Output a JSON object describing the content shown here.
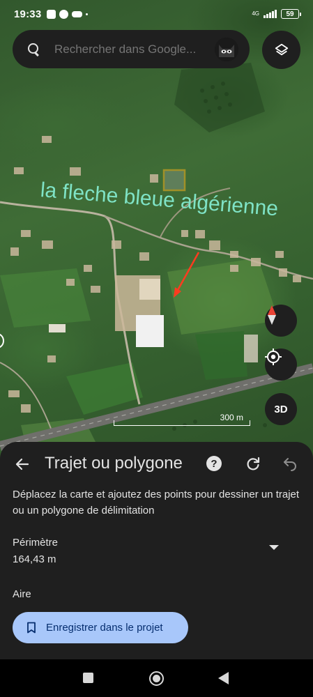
{
  "status_bar": {
    "time": "19:33",
    "network": "4G",
    "battery": "59"
  },
  "search": {
    "placeholder": "Rechercher dans Google..."
  },
  "map": {
    "overlay_text": "la fleche bleue algérienne",
    "scale_label": "300 m",
    "button_3d": "3D",
    "overlay_text_color": "#7fe3c6",
    "polygon_color": "#f2b01e",
    "arrow_color": "#ff3b1f"
  },
  "sheet": {
    "title": "Trajet ou polygone",
    "help_label": "?",
    "description": "Déplacez la carte et ajoutez des points pour dessiner un trajet ou un polygone de délimitation",
    "perimeter_label": "Périmètre",
    "perimeter_value": "164,43 m",
    "area_label": "Aire",
    "save_button": "Enregistrer dans le projet",
    "icons": [
      "arrow-back-icon",
      "help-icon",
      "redo-icon",
      "undo-icon",
      "bookmark-icon",
      "chevron-down-icon"
    ]
  },
  "nav_bar": {
    "icons": [
      "recents-icon",
      "home-icon",
      "back-icon"
    ]
  }
}
